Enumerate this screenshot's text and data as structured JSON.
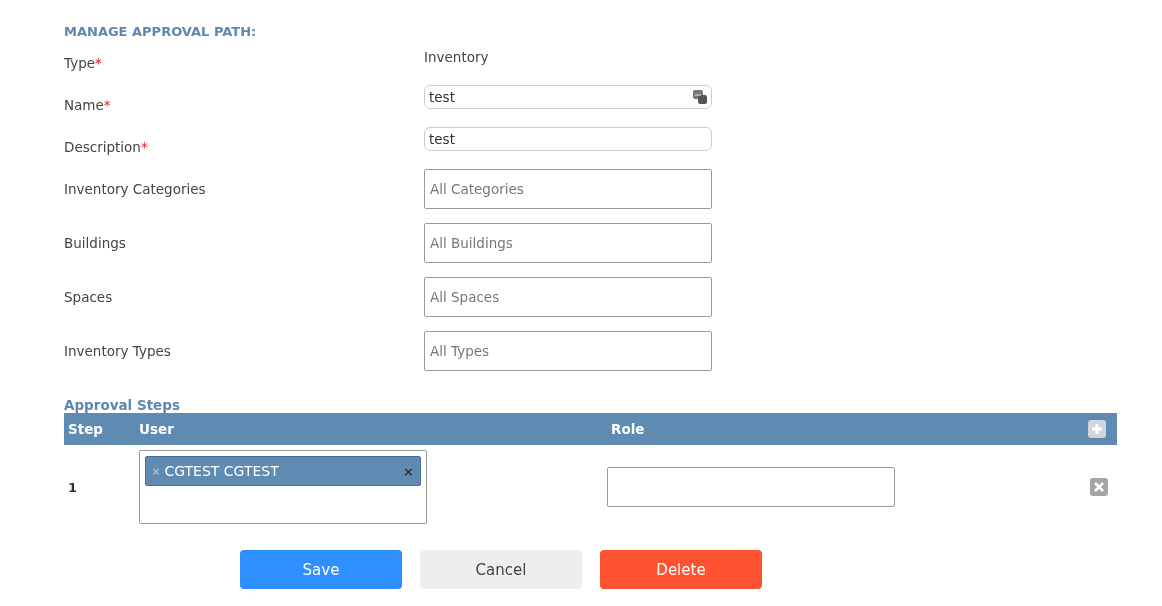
{
  "title": "MANAGE APPROVAL PATH:",
  "required_mark": "*",
  "fields": [
    {
      "label": "Type",
      "required": true,
      "kind": "static",
      "value": "Inventory"
    },
    {
      "label": "Name",
      "required": true,
      "kind": "text",
      "value": "test"
    },
    {
      "label": "Description",
      "required": true,
      "kind": "text",
      "value": "test"
    },
    {
      "label": "Inventory Categories",
      "required": false,
      "kind": "select",
      "placeholder": "All Categories"
    },
    {
      "label": "Buildings",
      "required": false,
      "kind": "select",
      "placeholder": "All Buildings"
    },
    {
      "label": "Spaces",
      "required": false,
      "kind": "select",
      "placeholder": "All Spaces"
    },
    {
      "label": "Inventory Types",
      "required": false,
      "kind": "select",
      "placeholder": "All Types"
    }
  ],
  "approval_steps": {
    "title": "Approval Steps",
    "columns": [
      "Step",
      "User",
      "Role"
    ],
    "rows": [
      {
        "step": "1",
        "users": [
          {
            "remove": "×",
            "name": "CGTEST CGTEST",
            "close": "×"
          }
        ]
      }
    ]
  },
  "buttons": [
    {
      "label": "Save",
      "kind": "primary"
    },
    {
      "label": "Cancel",
      "kind": "secondary"
    },
    {
      "label": "Delete",
      "kind": "danger"
    }
  ]
}
